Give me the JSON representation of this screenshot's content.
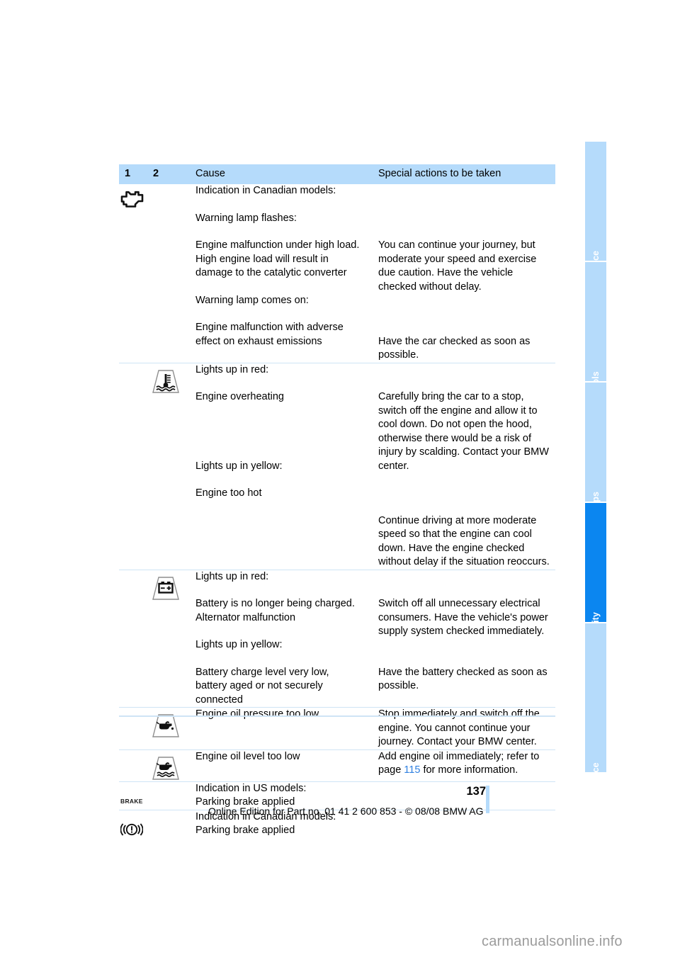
{
  "document": {
    "page_number": "137",
    "footer_note": "Online Edition for Part no. 01 41 2 600 853 - © 08/08 BMW AG",
    "watermark": "carmanualsonline.info"
  },
  "sidebar": {
    "tabs": [
      {
        "label": "At a glance",
        "active": false
      },
      {
        "label": "Controls",
        "active": false
      },
      {
        "label": "Driving tips",
        "active": false
      },
      {
        "label": "Mobility",
        "active": true
      },
      {
        "label": "Reference",
        "active": false
      }
    ]
  },
  "table": {
    "headers": {
      "col1": "1",
      "col2": "2",
      "col3": "Cause",
      "col4": "Special actions to be taken"
    },
    "rows": [
      {
        "icon_col": 1,
        "icon": "check-engine-icon",
        "cause_blocks": [
          "Indication in Canadian models:",
          "Warning lamp flashes:",
          "Engine malfunction under high load. High engine load will result in damage to the catalytic converter",
          "Warning lamp comes on:",
          "Engine malfunction with adverse effect on exhaust emissions"
        ],
        "action_blocks": [
          "",
          "",
          "You can continue your journey, but moderate your speed and exercise due caution. Have the vehicle checked without delay.",
          "",
          "Have the car checked as soon as possible."
        ]
      },
      {
        "icon_col": 2,
        "icon": "coolant-temperature-icon",
        "cause_blocks": [
          "Lights up in red:",
          "Engine overheating",
          "Lights up in yellow:",
          "Engine too hot"
        ],
        "action_blocks": [
          "",
          "Carefully bring the car to a stop, switch off the engine and allow it to cool down. Do not open the hood, otherwise there would be a risk of injury by scalding. Contact your BMW center.",
          "",
          "Continue driving at more moderate speed so that the engine can cool down. Have the engine checked without delay if the situation reoccurs."
        ]
      },
      {
        "icon_col": 2,
        "icon": "battery-charge-icon",
        "cause_blocks": [
          "Lights up in red:",
          "Battery is no longer being charged. Alternator malfunction",
          "Lights up in yellow:",
          "Battery charge level very low, battery aged or not securely connected"
        ],
        "action_blocks": [
          "",
          "Switch off all unnecessary electrical consumers. Have the vehicle's power supply system checked immediately.",
          "",
          "Have the battery checked as soon as possible."
        ]
      },
      {
        "icon_col": 2,
        "icon": "oil-pressure-icon",
        "cause_blocks": [
          "Engine oil pressure too low"
        ],
        "action_blocks": [
          "Stop immediately and switch off the engine. You cannot continue your journey. Contact your BMW center."
        ]
      },
      {
        "icon_col": 2,
        "icon": "oil-level-icon",
        "cause_blocks": [
          "Engine oil level too low"
        ],
        "action_blocks_rich": {
          "before": "Add engine oil immediately; refer to page ",
          "link": "115",
          "after": " for more information."
        }
      },
      {
        "icon_col": 1,
        "icon": "brake-text-icon",
        "icon_text": "BRAKE",
        "cause_blocks": [
          "Indication in US models:",
          "Parking brake applied"
        ],
        "action_blocks": [
          "",
          ""
        ]
      },
      {
        "icon_col": 1,
        "icon": "brake-warning-icon",
        "cause_blocks": [
          "Indication in Canadian models:",
          "Parking brake applied"
        ],
        "action_blocks": [
          "",
          ""
        ]
      }
    ]
  },
  "colors": {
    "header_bg": "#b5dbfb",
    "tab_inactive": "#b5dbfb",
    "tab_active": "#0b86f0",
    "rule": "#cfe4f5",
    "link": "#2d7fe0",
    "watermark": "#9b9b9b"
  }
}
